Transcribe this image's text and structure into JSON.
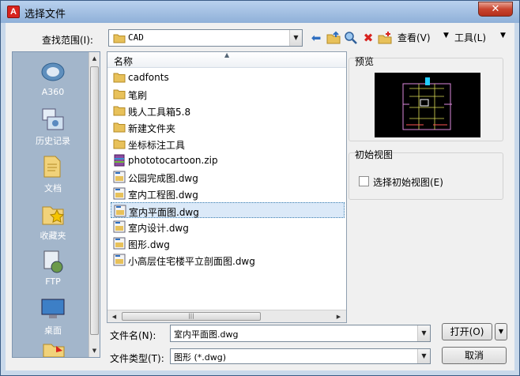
{
  "window": {
    "title": "选择文件",
    "app_icon_text": "A",
    "close_glyph": "✕"
  },
  "toolbar": {
    "lookin_label": "查找范围(I):",
    "lookin_value": "CAD",
    "view_label": "查看(V)",
    "tools_label": "工具(L)",
    "icons": [
      "back-arrow-icon",
      "up-folder-icon",
      "search-web-icon",
      "delete-icon",
      "new-folder-icon"
    ]
  },
  "places": [
    {
      "label": "A360",
      "icon": "a360-icon"
    },
    {
      "label": "历史记录",
      "icon": "history-icon"
    },
    {
      "label": "文档",
      "icon": "documents-icon"
    },
    {
      "label": "收藏夹",
      "icon": "favorites-icon"
    },
    {
      "label": "FTP",
      "icon": "ftp-icon"
    },
    {
      "label": "桌面",
      "icon": "desktop-icon"
    }
  ],
  "filelist": {
    "column_name": "名称",
    "files": [
      {
        "name": "cadfonts",
        "type": "folder"
      },
      {
        "name": "笔刷",
        "type": "folder"
      },
      {
        "name": "贱人工具箱5.8",
        "type": "folder"
      },
      {
        "name": "新建文件夹",
        "type": "folder"
      },
      {
        "name": "坐标标注工具",
        "type": "folder"
      },
      {
        "name": "phototocartoon.zip",
        "type": "zip"
      },
      {
        "name": "公园完成图.dwg",
        "type": "dwg"
      },
      {
        "name": "室内工程图.dwg",
        "type": "dwg"
      },
      {
        "name": "室内平面图.dwg",
        "type": "dwg",
        "selected": true
      },
      {
        "name": "室内设计.dwg",
        "type": "dwg"
      },
      {
        "name": "图形.dwg",
        "type": "dwg"
      },
      {
        "name": "小高层住宅楼平立剖面图.dwg",
        "type": "dwg"
      }
    ]
  },
  "preview": {
    "label": "预览"
  },
  "initial_view": {
    "label": "初始视图",
    "checkbox_label": "选择初始视图(E)",
    "checked": false
  },
  "filename": {
    "label": "文件名(N):",
    "value": "室内平面图.dwg"
  },
  "filetype": {
    "label": "文件类型(T):",
    "value": "图形 (*.dwg)"
  },
  "buttons": {
    "open": "打开(O)",
    "cancel": "取消"
  },
  "colors": {
    "title_bar": "#8fb0d8",
    "places_bg": "#a3b6cb",
    "selection": "#dbe9f8",
    "close_red": "#c9452f",
    "folder_yellow": "#e8c15a"
  }
}
